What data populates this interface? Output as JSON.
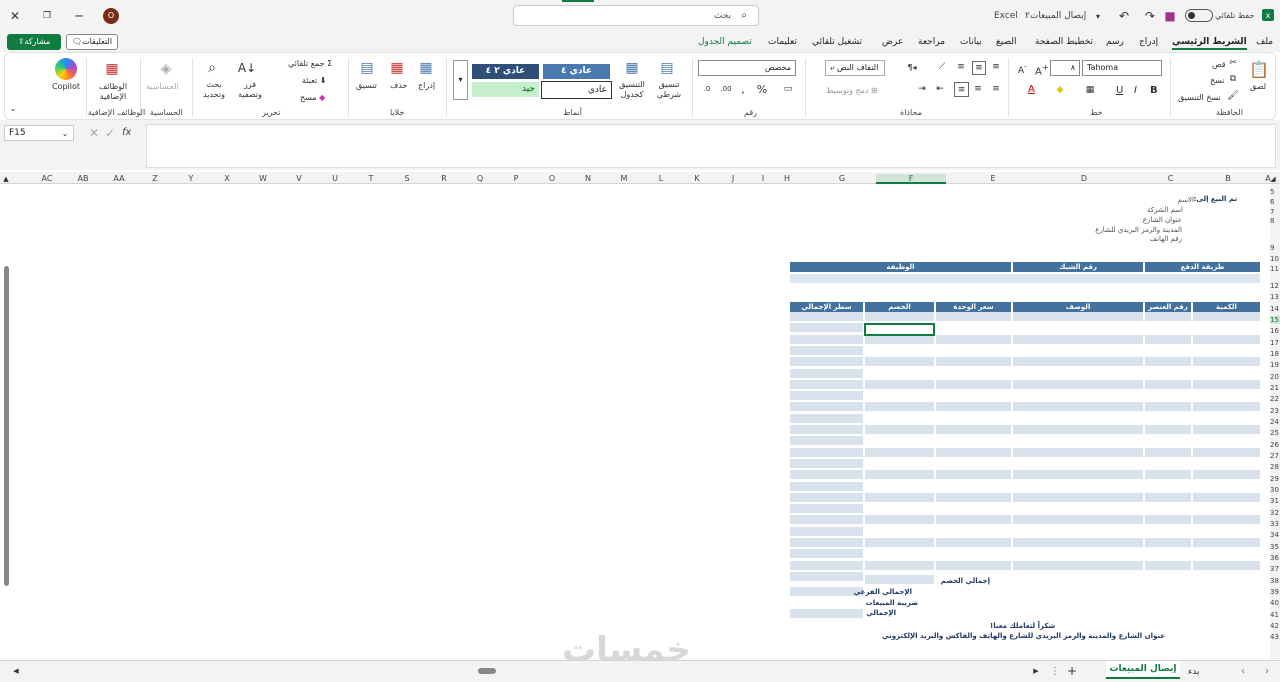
{
  "titlebar": {
    "autosave_label": "حفظ تلقائي",
    "filename": "إيصال المبيعات٢",
    "app": "Excel",
    "search_placeholder": "بحث",
    "avatar_initial": "O"
  },
  "tabs": [
    "ملف",
    "الشريط الرئيسي",
    "إدراج",
    "رسم",
    "تخطيط الصفحة",
    "الصيغ",
    "بيانات",
    "مراجعة",
    "عرض",
    "تشغيل تلقائي",
    "تعليمات",
    "تصميم الجدول"
  ],
  "actions": {
    "comments": "التعليقات",
    "share": "مشاركة"
  },
  "ribbon": {
    "clipboard": {
      "group": "الحافظة",
      "paste": "لصق",
      "cut": "قص",
      "copy": "نسخ",
      "format_painter": "نسخ التنسيق"
    },
    "font": {
      "group": "خط",
      "name": "Tahoma",
      "size": "٨"
    },
    "alignment": {
      "group": "محاذاة",
      "wrap": "التفاف النص",
      "merge": "دمج وتوسيط"
    },
    "number": {
      "group": "رقم",
      "format": "مخصص"
    },
    "styles": {
      "group": "أنماط",
      "conditional": "تنسيق شرطي",
      "as_table": "التنسيق كجدول",
      "style1": "عادي ٤",
      "style2": "عادي ٢ ٤",
      "style3": "عادي",
      "style4": "جيد"
    },
    "cells": {
      "group": "خلايا",
      "insert": "إدراج",
      "delete": "حذف",
      "format": "تنسيق"
    },
    "editing": {
      "group": "تحرير",
      "autosum": "جمع تلقائي",
      "fill": "تعبئة",
      "clear": "مسح",
      "sort": "فرز وتصفية",
      "find": "بحث وتحديد"
    },
    "sensitivity": {
      "group": "الحساسية",
      "label": "الحساسية"
    },
    "addins": {
      "group": "الوظائف الإضافية",
      "label": "الوظائف الإضافية"
    },
    "copilot": "Copilot"
  },
  "formula_bar": {
    "name_box": "F15",
    "fx": "fx",
    "value": ""
  },
  "columns": [
    "A",
    "B",
    "C",
    "D",
    "E",
    "F",
    "G",
    "H",
    "I",
    "J",
    "K",
    "L",
    "M",
    "N",
    "O",
    "P",
    "Q",
    "R",
    "S",
    "T",
    "U",
    "V",
    "W",
    "X",
    "Y",
    "Z",
    "AA",
    "AB",
    "AC"
  ],
  "sheet": {
    "sold_to": "تم البيع إلى:",
    "name": "الاسم",
    "company": "اسم الشركة",
    "address": "عنوان الشارع",
    "city": "المدينة والرمز البريدي للشارع",
    "phone": "رقم الهاتف",
    "payment_method": "طريقة الدفع",
    "check_no": "رقم الشيك",
    "job": "الوظيفة",
    "qty": "الكمية",
    "item_no": "رقم العنصر",
    "desc": "الوصف",
    "unit_price": "سعر الوحدة",
    "discount": "الخصم",
    "line_total": "سطر الإجمالي",
    "total_discount": "إجمالي الخصم",
    "subtotal": "الإجمالي الفرعي",
    "tax": "ضريبة المبيعات",
    "total": "الإجمالي",
    "thanks": "شكراً لتعاملك معنا!",
    "footer": "عنوان الشارع والمدينة والرمز البريدي للشارع والهاتف والفاكس والبريد الإلكتروني"
  },
  "row_numbers": [
    "5",
    "6",
    "7",
    "8",
    "9",
    "10",
    "11",
    "12",
    "13",
    "14",
    "15",
    "16",
    "17",
    "18",
    "19",
    "20",
    "21",
    "22",
    "23",
    "24",
    "25",
    "26",
    "27",
    "28",
    "29",
    "30",
    "31",
    "32",
    "33",
    "34",
    "35",
    "36",
    "37",
    "38",
    "39",
    "40",
    "41",
    "42",
    "43"
  ],
  "sheet_tabs": {
    "start": "بدء",
    "active": "إيصال المبيعات"
  },
  "watermark": "خمسات"
}
